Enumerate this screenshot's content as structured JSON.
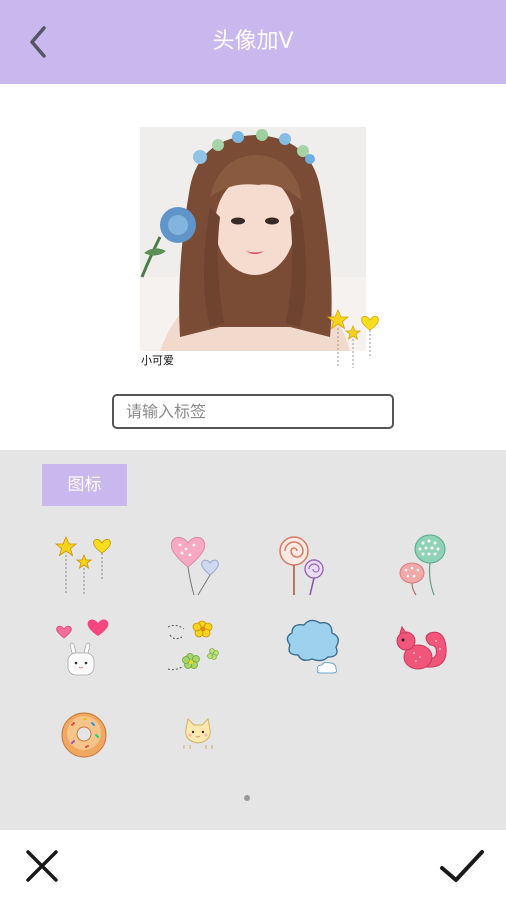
{
  "header": {
    "title": "头像加V",
    "back_icon": "chevron-left-icon"
  },
  "photo": {
    "label": "小可爱",
    "sticker": "stars-hearts-sticker"
  },
  "tag_input": {
    "placeholder": "请输入标签",
    "value": ""
  },
  "panel": {
    "tab_label": "图标",
    "stickers": [
      "stars-hearts-sticker",
      "pink-heart-balloons-sticker",
      "lollipops-sticker",
      "polka-dot-balloons-sticker",
      "bunny-hearts-sticker",
      "flowers-sticker",
      "blue-cloud-sticker",
      "pink-squirrel-sticker",
      "donut-sticker",
      "kitten-sticker"
    ],
    "page_indicator": {
      "current": 1,
      "total": 1
    }
  },
  "bottom_bar": {
    "cancel_icon": "close-icon",
    "confirm_icon": "checkmark-icon"
  },
  "colors": {
    "accent": "#c9b8ed",
    "panel_background": "#e5e5e5"
  }
}
